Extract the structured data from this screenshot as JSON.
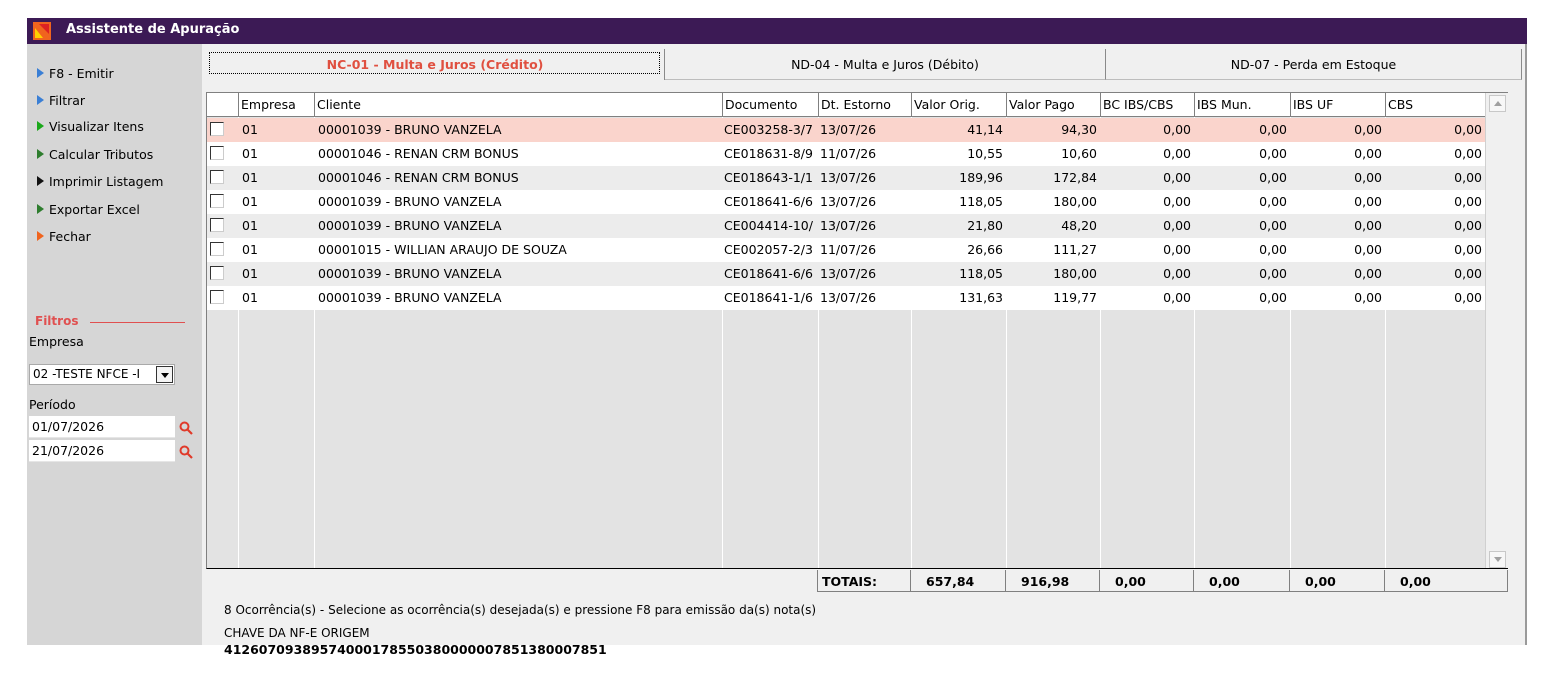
{
  "window": {
    "title": "Assistente de Apuração"
  },
  "sidebar": {
    "items": [
      {
        "label": "F8 - Emitir",
        "color": "#3a7fd5"
      },
      {
        "label": "Filtrar",
        "color": "#3a7fd5"
      },
      {
        "label": "Visualizar Itens",
        "color": "#1aa81a"
      },
      {
        "label": "Calcular Tributos",
        "color": "#2e7d2e"
      },
      {
        "label": "Imprimir Listagem",
        "color": "#111111"
      },
      {
        "label": "Exportar Excel",
        "color": "#2e7d2e"
      },
      {
        "label": "Fechar",
        "color": "#f0641e"
      }
    ],
    "filters_title": "Filtros",
    "empresa_label": "Empresa",
    "empresa_value": "02 -TESTE NFCE -I",
    "periodo_label": "Período",
    "date_from": "01/07/2026",
    "date_to": "21/07/2026"
  },
  "tabs": [
    {
      "label": "NC-01 - Multa e Juros (Crédito)",
      "active": true
    },
    {
      "label": "ND-04 - Multa e Juros (Débito)",
      "active": false
    },
    {
      "label": "ND-07 - Perda em Estoque",
      "active": false
    }
  ],
  "grid": {
    "headers": {
      "empresa": "Empresa",
      "cliente": "Cliente",
      "documento": "Documento",
      "dt_estorno": "Dt. Estorno",
      "valor_orig": "Valor Orig.",
      "valor_pago": "Valor Pago",
      "bc": "BC IBS/CBS",
      "ibs_mun": "IBS Mun.",
      "ibs_uf": "IBS UF",
      "cbs": "CBS"
    },
    "rows": [
      {
        "empresa": "01",
        "cliente": "00001039 - BRUNO VANZELA",
        "documento": "CE003258-3/7",
        "dt": "13/07/26",
        "orig": "41,14",
        "pago": "94,30",
        "bc": "0,00",
        "mun": "0,00",
        "uf": "0,00",
        "cbs": "0,00"
      },
      {
        "empresa": "01",
        "cliente": "00001046 - RENAN CRM BONUS",
        "documento": "CE018631-8/9",
        "dt": "11/07/26",
        "orig": "10,55",
        "pago": "10,60",
        "bc": "0,00",
        "mun": "0,00",
        "uf": "0,00",
        "cbs": "0,00"
      },
      {
        "empresa": "01",
        "cliente": "00001046 - RENAN CRM BONUS",
        "documento": "CE018643-1/1",
        "dt": "13/07/26",
        "orig": "189,96",
        "pago": "172,84",
        "bc": "0,00",
        "mun": "0,00",
        "uf": "0,00",
        "cbs": "0,00"
      },
      {
        "empresa": "01",
        "cliente": "00001039 - BRUNO VANZELA",
        "documento": "CE018641-6/6",
        "dt": "13/07/26",
        "orig": "118,05",
        "pago": "180,00",
        "bc": "0,00",
        "mun": "0,00",
        "uf": "0,00",
        "cbs": "0,00"
      },
      {
        "empresa": "01",
        "cliente": "00001039 - BRUNO VANZELA",
        "documento": "CE004414-10/",
        "dt": "13/07/26",
        "orig": "21,80",
        "pago": "48,20",
        "bc": "0,00",
        "mun": "0,00",
        "uf": "0,00",
        "cbs": "0,00"
      },
      {
        "empresa": "01",
        "cliente": "00001015 - WILLIAN ARAUJO DE SOUZA",
        "documento": "CE002057-2/3",
        "dt": "11/07/26",
        "orig": "26,66",
        "pago": "111,27",
        "bc": "0,00",
        "mun": "0,00",
        "uf": "0,00",
        "cbs": "0,00"
      },
      {
        "empresa": "01",
        "cliente": "00001039 - BRUNO VANZELA",
        "documento": "CE018641-6/6",
        "dt": "13/07/26",
        "orig": "118,05",
        "pago": "180,00",
        "bc": "0,00",
        "mun": "0,00",
        "uf": "0,00",
        "cbs": "0,00"
      },
      {
        "empresa": "01",
        "cliente": "00001039 - BRUNO VANZELA",
        "documento": "CE018641-1/6",
        "dt": "13/07/26",
        "orig": "131,63",
        "pago": "119,77",
        "bc": "0,00",
        "mun": "0,00",
        "uf": "0,00",
        "cbs": "0,00"
      }
    ],
    "selected_row_color": "#fad4cc"
  },
  "totals": {
    "label": "TOTAIS:",
    "orig": "657,84",
    "pago": "916,98",
    "bc": "0,00",
    "mun": "0,00",
    "uf": "0,00",
    "cbs": "0,00"
  },
  "footer": {
    "status": "8 Ocorrência(s) - Selecione as ocorrência(s) desejada(s) e pressione F8 para emissão da(s) nota(s)",
    "chave_label": "CHAVE DA NF-E ORIGEM",
    "chave_value": "41260709389574000178550380000007851380007851"
  },
  "colors": {
    "titlebar": "#3c1a55",
    "accent": "#e05040"
  }
}
